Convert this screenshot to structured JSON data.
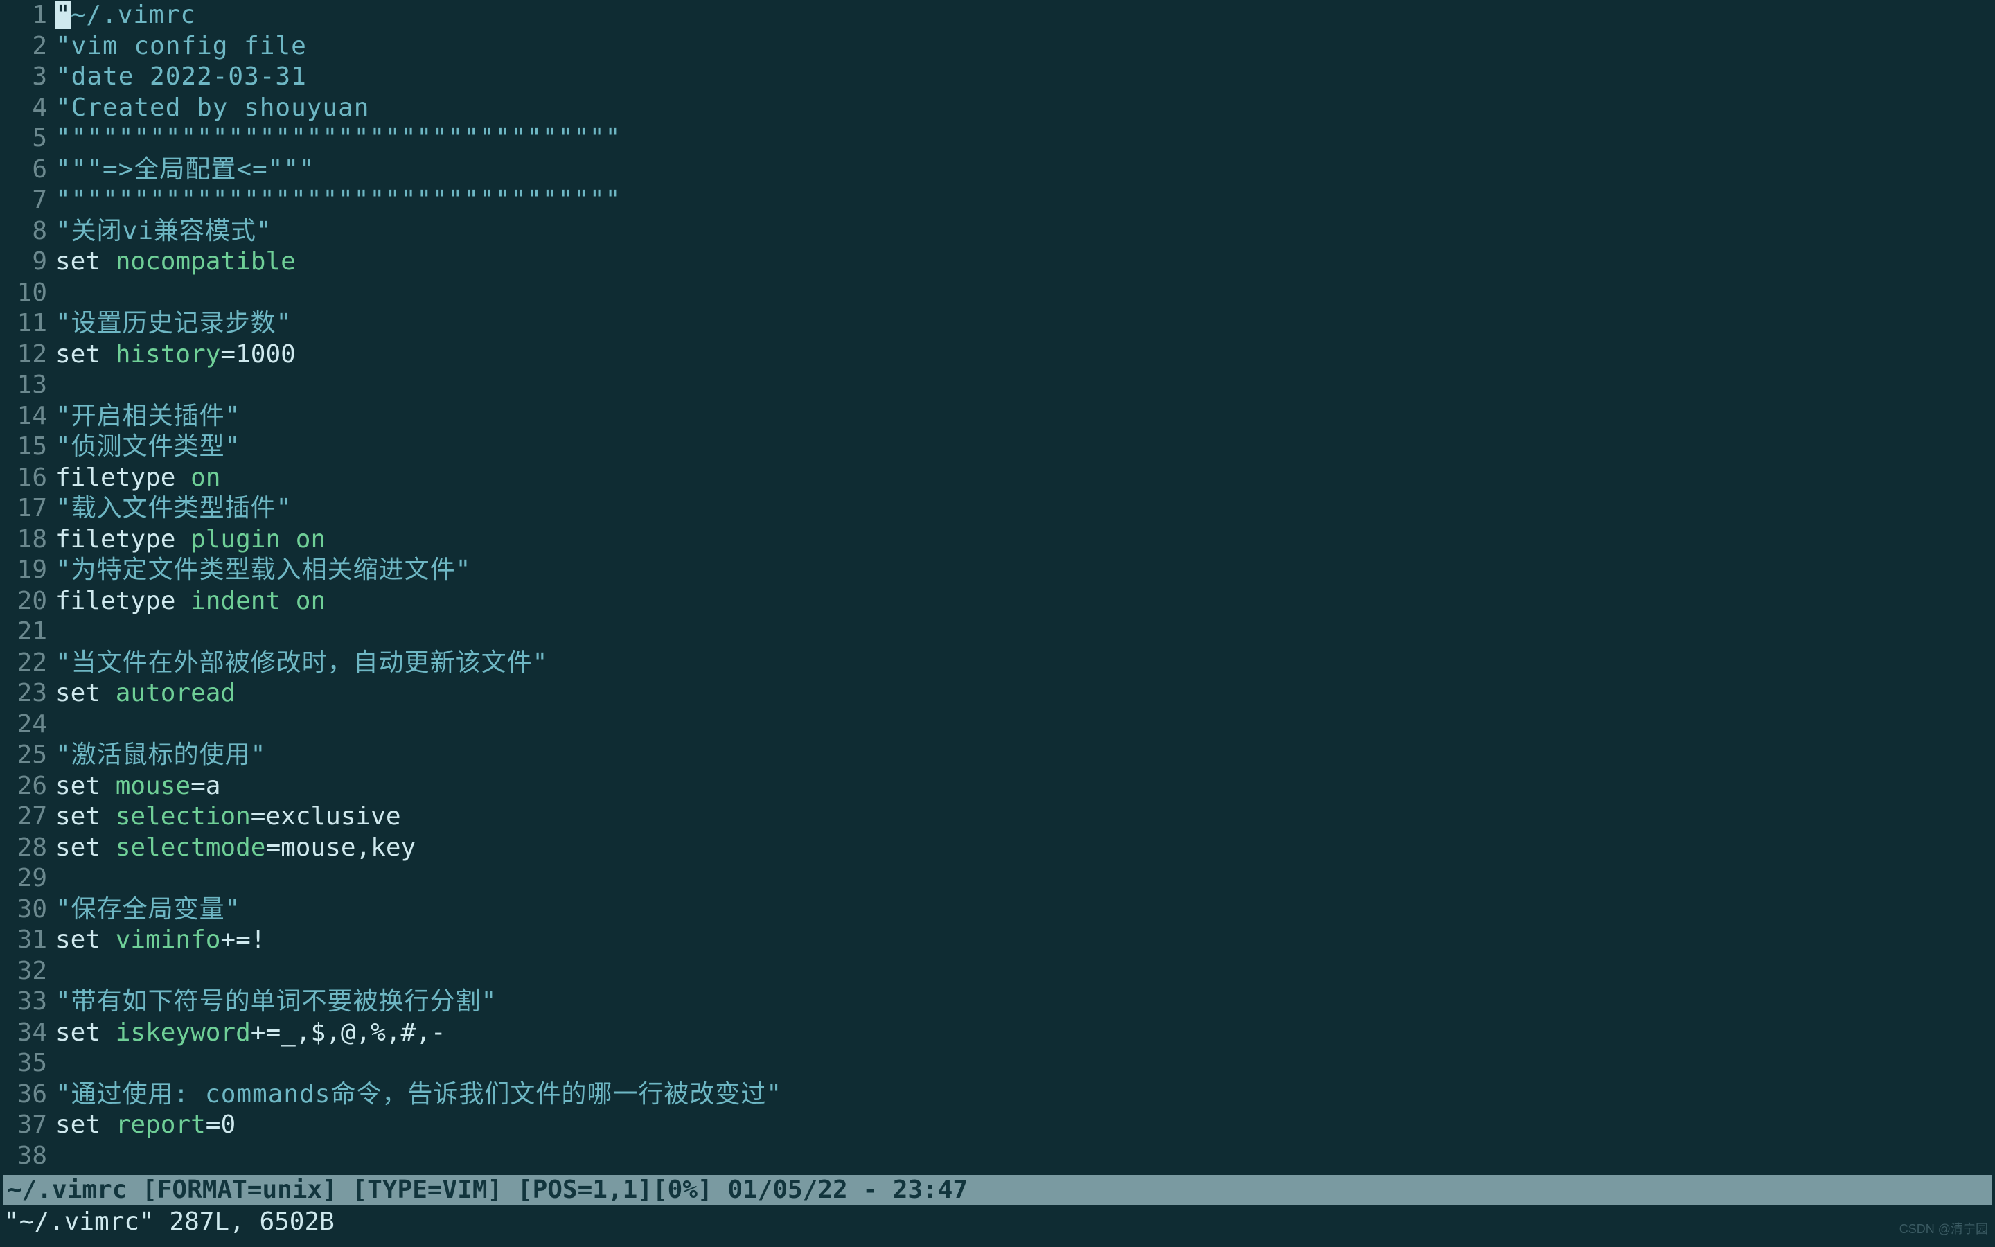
{
  "lines": [
    {
      "n": 1,
      "segments": [
        {
          "cls": "cursor",
          "t": "\""
        },
        {
          "cls": "comment",
          "t": "~/.vimrc"
        }
      ]
    },
    {
      "n": 2,
      "segments": [
        {
          "cls": "comment",
          "t": "\"vim config file"
        }
      ]
    },
    {
      "n": 3,
      "segments": [
        {
          "cls": "comment",
          "t": "\"date 2022-03-31"
        }
      ]
    },
    {
      "n": 4,
      "segments": [
        {
          "cls": "comment",
          "t": "\"Created by shouyuan"
        }
      ]
    },
    {
      "n": 5,
      "segments": [
        {
          "cls": "comment",
          "t": "\"\"\"\"\"\"\"\"\"\"\"\"\"\"\"\"\"\"\"\"\"\"\"\"\"\"\"\"\"\"\"\"\"\"\"\""
        }
      ]
    },
    {
      "n": 6,
      "segments": [
        {
          "cls": "comment",
          "t": "\"\"\"=>全局配置<=\"\"\""
        }
      ]
    },
    {
      "n": 7,
      "segments": [
        {
          "cls": "comment",
          "t": "\"\"\"\"\"\"\"\"\"\"\"\"\"\"\"\"\"\"\"\"\"\"\"\"\"\"\"\"\"\"\"\"\"\"\"\""
        }
      ]
    },
    {
      "n": 8,
      "segments": [
        {
          "cls": "comment",
          "t": "\"关闭vi兼容模式\""
        }
      ]
    },
    {
      "n": 9,
      "segments": [
        {
          "cls": "keyword",
          "t": "set "
        },
        {
          "cls": "option",
          "t": "nocompatible"
        }
      ]
    },
    {
      "n": 10,
      "segments": [
        {
          "cls": "code",
          "t": ""
        }
      ]
    },
    {
      "n": 11,
      "segments": [
        {
          "cls": "comment",
          "t": "\"设置历史记录步数\""
        }
      ]
    },
    {
      "n": 12,
      "segments": [
        {
          "cls": "keyword",
          "t": "set "
        },
        {
          "cls": "option",
          "t": "history"
        },
        {
          "cls": "keyword",
          "t": "="
        },
        {
          "cls": "number",
          "t": "1000"
        }
      ]
    },
    {
      "n": 13,
      "segments": [
        {
          "cls": "code",
          "t": ""
        }
      ]
    },
    {
      "n": 14,
      "segments": [
        {
          "cls": "comment",
          "t": "\"开启相关插件\""
        }
      ]
    },
    {
      "n": 15,
      "segments": [
        {
          "cls": "comment",
          "t": "\"侦测文件类型\""
        }
      ]
    },
    {
      "n": 16,
      "segments": [
        {
          "cls": "keyword",
          "t": "filetype "
        },
        {
          "cls": "option",
          "t": "on"
        }
      ]
    },
    {
      "n": 17,
      "segments": [
        {
          "cls": "comment",
          "t": "\"载入文件类型插件\""
        }
      ]
    },
    {
      "n": 18,
      "segments": [
        {
          "cls": "keyword",
          "t": "filetype "
        },
        {
          "cls": "option",
          "t": "plugin on"
        }
      ]
    },
    {
      "n": 19,
      "segments": [
        {
          "cls": "comment",
          "t": "\"为特定文件类型载入相关缩进文件\""
        }
      ]
    },
    {
      "n": 20,
      "segments": [
        {
          "cls": "keyword",
          "t": "filetype "
        },
        {
          "cls": "option",
          "t": "indent on"
        }
      ]
    },
    {
      "n": 21,
      "segments": [
        {
          "cls": "code",
          "t": ""
        }
      ]
    },
    {
      "n": 22,
      "segments": [
        {
          "cls": "comment",
          "t": "\"当文件在外部被修改时，自动更新该文件\""
        }
      ]
    },
    {
      "n": 23,
      "segments": [
        {
          "cls": "keyword",
          "t": "set "
        },
        {
          "cls": "option",
          "t": "autoread"
        }
      ]
    },
    {
      "n": 24,
      "segments": [
        {
          "cls": "code",
          "t": ""
        }
      ]
    },
    {
      "n": 25,
      "segments": [
        {
          "cls": "comment",
          "t": "\"激活鼠标的使用\""
        }
      ]
    },
    {
      "n": 26,
      "segments": [
        {
          "cls": "keyword",
          "t": "set "
        },
        {
          "cls": "option",
          "t": "mouse"
        },
        {
          "cls": "keyword",
          "t": "=a"
        }
      ]
    },
    {
      "n": 27,
      "segments": [
        {
          "cls": "keyword",
          "t": "set "
        },
        {
          "cls": "option",
          "t": "selection"
        },
        {
          "cls": "keyword",
          "t": "=exclusive"
        }
      ]
    },
    {
      "n": 28,
      "segments": [
        {
          "cls": "keyword",
          "t": "set "
        },
        {
          "cls": "option",
          "t": "selectmode"
        },
        {
          "cls": "keyword",
          "t": "=mouse,key"
        }
      ]
    },
    {
      "n": 29,
      "segments": [
        {
          "cls": "code",
          "t": ""
        }
      ]
    },
    {
      "n": 30,
      "segments": [
        {
          "cls": "comment",
          "t": "\"保存全局变量\""
        }
      ]
    },
    {
      "n": 31,
      "segments": [
        {
          "cls": "keyword",
          "t": "set "
        },
        {
          "cls": "option",
          "t": "viminfo"
        },
        {
          "cls": "keyword",
          "t": "+=!"
        }
      ]
    },
    {
      "n": 32,
      "segments": [
        {
          "cls": "code",
          "t": ""
        }
      ]
    },
    {
      "n": 33,
      "segments": [
        {
          "cls": "comment",
          "t": "\"带有如下符号的单词不要被换行分割\""
        }
      ]
    },
    {
      "n": 34,
      "segments": [
        {
          "cls": "keyword",
          "t": "set "
        },
        {
          "cls": "option",
          "t": "iskeyword"
        },
        {
          "cls": "keyword",
          "t": "+=_,$,@,%,#,-"
        }
      ]
    },
    {
      "n": 35,
      "segments": [
        {
          "cls": "code",
          "t": ""
        }
      ]
    },
    {
      "n": 36,
      "segments": [
        {
          "cls": "comment",
          "t": "\"通过使用: commands命令，告诉我们文件的哪一行被改变过\""
        }
      ]
    },
    {
      "n": 37,
      "segments": [
        {
          "cls": "keyword",
          "t": "set "
        },
        {
          "cls": "option",
          "t": "report"
        },
        {
          "cls": "keyword",
          "t": "="
        },
        {
          "cls": "number",
          "t": "0"
        }
      ]
    },
    {
      "n": 38,
      "segments": [
        {
          "cls": "code",
          "t": ""
        }
      ]
    }
  ],
  "statusbar": "~/.vimrc [FORMAT=unix] [TYPE=VIM] [POS=1,1][0%] 01/05/22 - 23:47",
  "messagebar": "\"~/.vimrc\" 287L, 6502B",
  "watermark": "CSDN @清宁园"
}
